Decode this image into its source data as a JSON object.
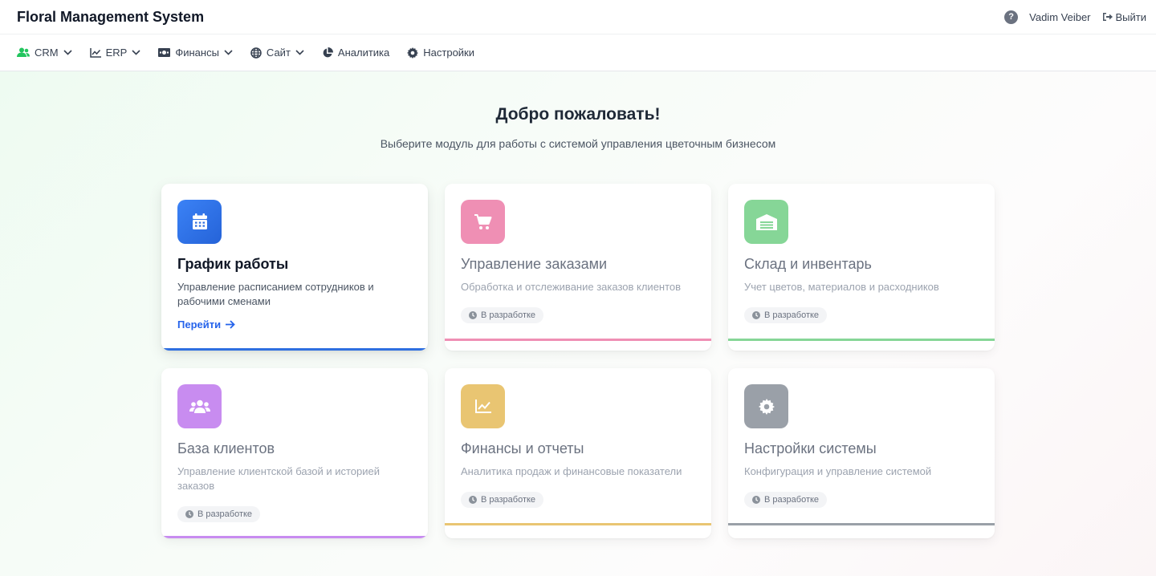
{
  "app": {
    "title": "Floral Management System",
    "user_name": "Vadim Veiber",
    "logout_label": "Выйти"
  },
  "nav": [
    {
      "label": "CRM",
      "icon": "users-icon",
      "dropdown": true
    },
    {
      "label": "ERP",
      "icon": "chart-line-icon",
      "dropdown": true
    },
    {
      "label": "Финансы",
      "icon": "money-icon",
      "dropdown": true
    },
    {
      "label": "Сайт",
      "icon": "globe-icon",
      "dropdown": true
    },
    {
      "label": "Аналитика",
      "icon": "pie-chart-icon",
      "dropdown": false
    },
    {
      "label": "Настройки",
      "icon": "gear-icon",
      "dropdown": false
    }
  ],
  "welcome": {
    "title": "Добро пожаловать!",
    "subtitle": "Выберите модуль для работы с системой управления цветочным бизнесом"
  },
  "modules": [
    {
      "title": "График работы",
      "description": "Управление расписанием сотрудников и рабочими сменами",
      "action": "Перейти",
      "status": "",
      "color": "#2f6fe0",
      "icon": "calendar-icon",
      "active": true
    },
    {
      "title": "Управление заказами",
      "description": "Обработка и отслеживание заказов клиентов",
      "action": "",
      "status": "В разработке",
      "color": "#ef8fb4",
      "icon": "cart-icon",
      "active": false
    },
    {
      "title": "Склад и инвентарь",
      "description": "Учет цветов, материалов и расходников",
      "action": "",
      "status": "В разработке",
      "color": "#86d697",
      "icon": "warehouse-icon",
      "active": false
    },
    {
      "title": "База клиентов",
      "description": "Управление клиентской базой и историей заказов",
      "action": "",
      "status": "В разработке",
      "color": "#c88cf0",
      "icon": "users-icon",
      "active": false
    },
    {
      "title": "Финансы и отчеты",
      "description": "Аналитика продаж и финансовые показатели",
      "action": "",
      "status": "В разработке",
      "color": "#e9c572",
      "icon": "chart-line-icon",
      "active": false
    },
    {
      "title": "Настройки системы",
      "description": "Конфигурация и управление системой",
      "action": "",
      "status": "В разработке",
      "color": "#9aa0a8",
      "icon": "gear-icon",
      "active": false
    }
  ],
  "colors": {
    "accent_blue": "#2563eb",
    "nav_crm_icon": "#22c55e"
  }
}
